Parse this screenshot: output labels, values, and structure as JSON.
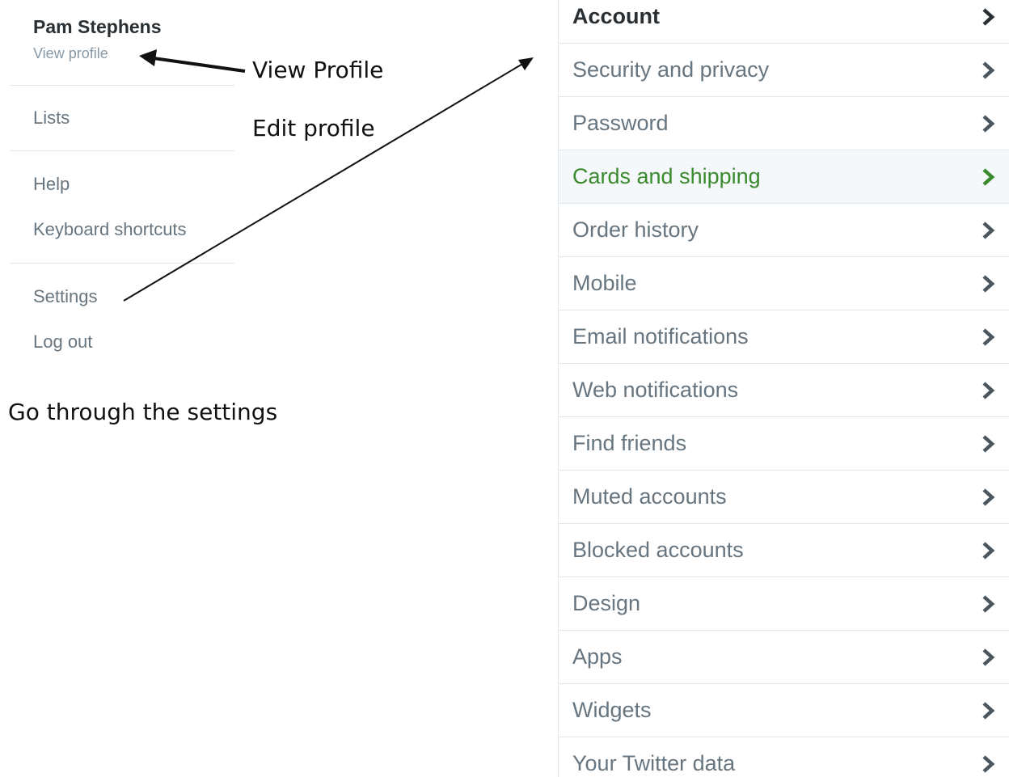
{
  "menu": {
    "user_name": "Pam Stephens",
    "view_profile": "View profile",
    "items": [
      "Lists",
      "Help",
      "Keyboard shortcuts",
      "Settings",
      "Log out"
    ]
  },
  "annotations": {
    "view_profile": "View Profile",
    "edit_profile": "Edit profile",
    "go_through": "Go through the settings"
  },
  "settings_nav": {
    "items": [
      {
        "label": "Account",
        "state": "active"
      },
      {
        "label": "Security and privacy",
        "state": "normal"
      },
      {
        "label": "Password",
        "state": "normal"
      },
      {
        "label": "Cards and shipping",
        "state": "hover"
      },
      {
        "label": "Order history",
        "state": "normal"
      },
      {
        "label": "Mobile",
        "state": "normal"
      },
      {
        "label": "Email notifications",
        "state": "normal"
      },
      {
        "label": "Web notifications",
        "state": "normal"
      },
      {
        "label": "Find friends",
        "state": "normal"
      },
      {
        "label": "Muted accounts",
        "state": "normal"
      },
      {
        "label": "Blocked accounts",
        "state": "normal"
      },
      {
        "label": "Design",
        "state": "normal"
      },
      {
        "label": "Apps",
        "state": "normal"
      },
      {
        "label": "Widgets",
        "state": "normal"
      },
      {
        "label": "Your Twitter data",
        "state": "normal"
      }
    ],
    "chevron_icon": "chevron-right-icon"
  },
  "colors": {
    "text_dark": "#292f33",
    "text_muted": "#66757f",
    "hover_green": "#3a8a2e",
    "hover_bg": "#f5f8fa",
    "divider": "#e1e8ed"
  }
}
